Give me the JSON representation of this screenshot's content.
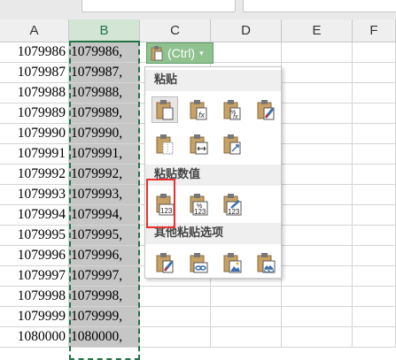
{
  "columns": [
    {
      "letter": "A",
      "selected": false
    },
    {
      "letter": "B",
      "selected": true
    },
    {
      "letter": "C",
      "selected": false
    },
    {
      "letter": "D",
      "selected": false
    },
    {
      "letter": "E",
      "selected": false
    },
    {
      "letter": "F",
      "selected": false
    }
  ],
  "rows": [
    {
      "a": "1079986",
      "b": "1079986,"
    },
    {
      "a": "1079987",
      "b": "1079987,"
    },
    {
      "a": "1079988",
      "b": "1079988,"
    },
    {
      "a": "1079989",
      "b": "1079989,"
    },
    {
      "a": "1079990",
      "b": "1079990,"
    },
    {
      "a": "1079991",
      "b": "1079991,"
    },
    {
      "a": "1079992",
      "b": "1079992,"
    },
    {
      "a": "1079993",
      "b": "1079993,"
    },
    {
      "a": "1079994",
      "b": "1079994,"
    },
    {
      "a": "1079995",
      "b": "1079995,"
    },
    {
      "a": "1079996",
      "b": "1079996,"
    },
    {
      "a": "1079997",
      "b": "1079997,"
    },
    {
      "a": "1079998",
      "b": "1079998,"
    },
    {
      "a": "1079999",
      "b": "1079999,"
    },
    {
      "a": "1080000",
      "b": "1080000,"
    }
  ],
  "paste_options_button": {
    "label": "(Ctrl)",
    "icon": "clipboard-icon",
    "caret": "▾",
    "color": "#8fc28f"
  },
  "paste_menu": {
    "sections": [
      {
        "title": "粘贴",
        "items": [
          {
            "icon": "paste-icon",
            "active": true
          },
          {
            "icon": "paste-formulas-icon"
          },
          {
            "icon": "paste-formulas-number-format-icon"
          },
          {
            "icon": "keep-source-formatting-icon"
          },
          {
            "icon": "no-borders-icon"
          },
          {
            "icon": "keep-column-widths-icon"
          },
          {
            "icon": "transpose-icon"
          }
        ]
      },
      {
        "title": "粘贴数值",
        "items": [
          {
            "icon": "paste-values-icon",
            "highlighted": true
          },
          {
            "icon": "values-number-format-icon"
          },
          {
            "icon": "values-source-formatting-icon"
          }
        ]
      },
      {
        "title": "其他粘贴选项",
        "items": [
          {
            "icon": "paste-formatting-icon"
          },
          {
            "icon": "paste-link-icon"
          },
          {
            "icon": "paste-picture-icon"
          },
          {
            "icon": "linked-picture-icon"
          }
        ]
      }
    ]
  },
  "colors": {
    "selection_border": "#217346",
    "highlight_box": "#e8312d",
    "selected_fill": "#c6c6c6"
  }
}
